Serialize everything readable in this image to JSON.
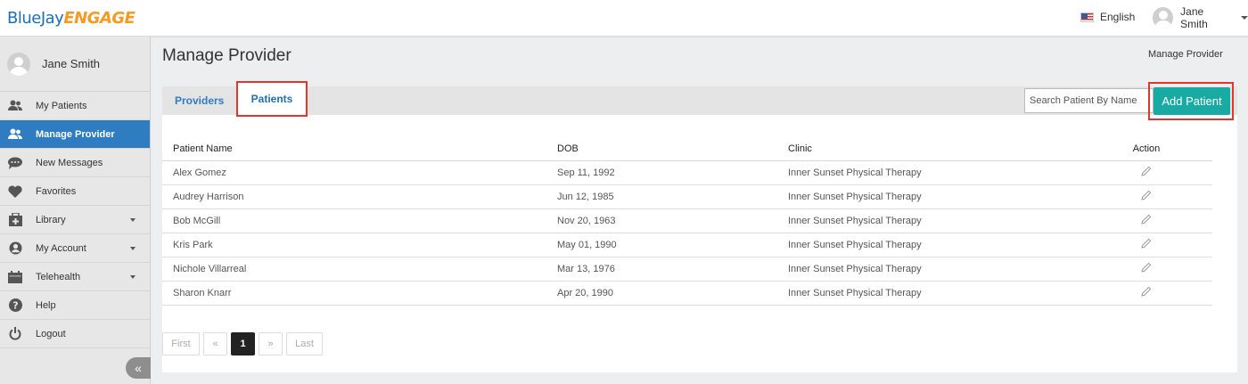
{
  "brand": {
    "part1": "BlueJay",
    "part2": "ENGAGE"
  },
  "topbar": {
    "language": "English",
    "user_name": "Jane Smith"
  },
  "sidebar": {
    "user_name": "Jane Smith",
    "items": [
      {
        "label": "My Patients",
        "icon": "patients-icon"
      },
      {
        "label": "Manage Provider",
        "icon": "providers-icon"
      },
      {
        "label": "New Messages",
        "icon": "chat-icon"
      },
      {
        "label": "Favorites",
        "icon": "heart-icon"
      },
      {
        "label": "Library",
        "icon": "library-icon"
      },
      {
        "label": "My Account",
        "icon": "account-icon"
      },
      {
        "label": "Telehealth",
        "icon": "calendar-icon"
      },
      {
        "label": "Help",
        "icon": "help-icon"
      },
      {
        "label": "Logout",
        "icon": "power-icon"
      }
    ],
    "collapse_label": "«"
  },
  "page": {
    "title": "Manage Provider",
    "breadcrumb": "Manage Provider"
  },
  "tabs": {
    "providers": "Providers",
    "patients": "Patients"
  },
  "search": {
    "placeholder": "Search Patient By Name"
  },
  "add_button": "Add Patient",
  "table": {
    "headers": [
      "Patient Name",
      "DOB",
      "Clinic",
      "Action"
    ],
    "rows": [
      [
        "Alex Gomez",
        "Sep 11, 1992",
        "Inner Sunset Physical Therapy"
      ],
      [
        "Audrey Harrison",
        "Jun 12, 1985",
        "Inner Sunset Physical Therapy"
      ],
      [
        "Bob McGill",
        "Nov 20, 1963",
        "Inner Sunset Physical Therapy"
      ],
      [
        "Kris Park",
        "May 01, 1990",
        "Inner Sunset Physical Therapy"
      ],
      [
        "Nichole Villarreal",
        "Mar 13, 1976",
        "Inner Sunset Physical Therapy"
      ],
      [
        "Sharon Knarr",
        "Apr 20, 1990",
        "Inner Sunset Physical Therapy"
      ]
    ]
  },
  "pagination": {
    "first": "First",
    "prev": "«",
    "current": "1",
    "next": "»",
    "last": "Last"
  },
  "colors": {
    "accent": "#2f7cc0",
    "add_button": "#19aaa4",
    "highlight_border": "#e0362b"
  }
}
